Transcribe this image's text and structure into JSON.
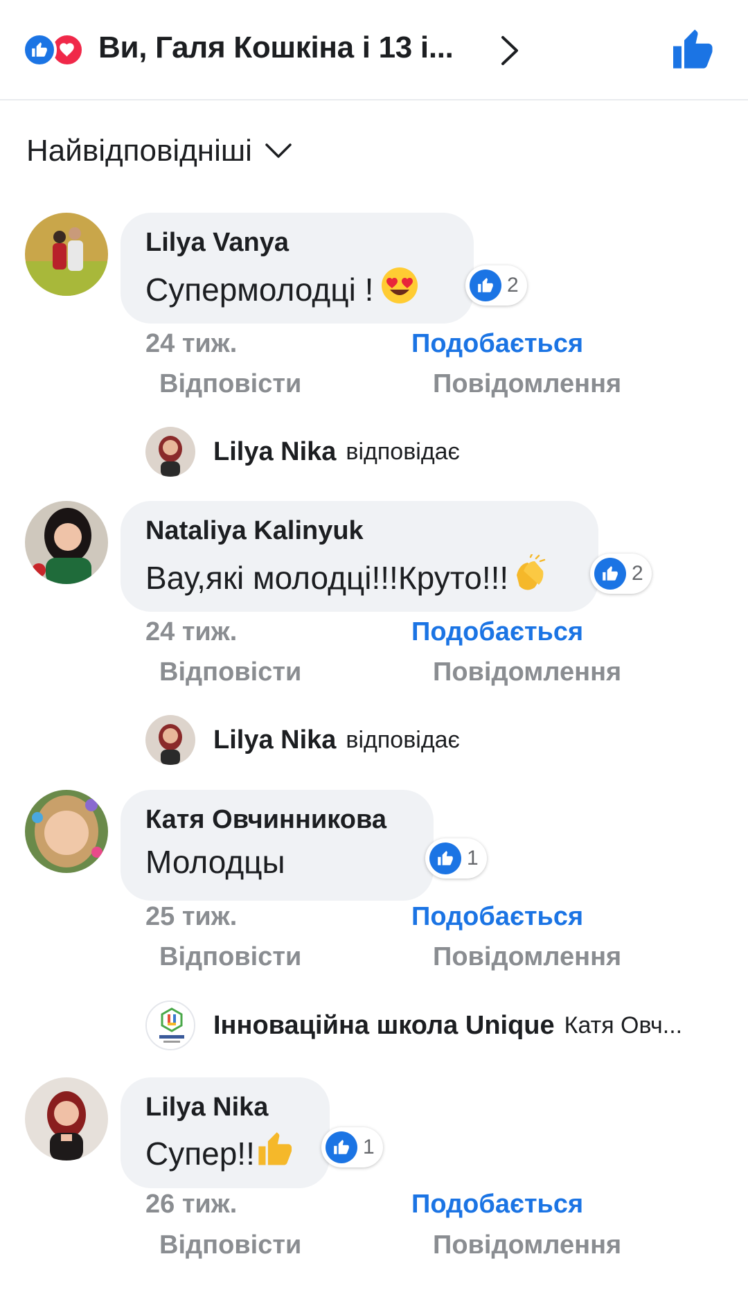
{
  "header": {
    "title": "Ви, Галя Кошкіна і 13 і...",
    "reaction_icons": [
      "like-icon",
      "love-icon"
    ],
    "accent_color": "#1b74e4",
    "love_color": "#f02849"
  },
  "sort": {
    "label": "Найвідповідніші"
  },
  "comments": [
    {
      "author": "Lilya Vanya",
      "text": "Супермолодці  !",
      "emoji": "heart-eyes-emoji",
      "reaction_count": "2",
      "time": "24 тиж.",
      "like_label": "Подобається",
      "reply_label": "Відповісти",
      "report_label": "Повідомлення",
      "reply": {
        "author": "Lilya Nika",
        "action": "відповідає"
      }
    },
    {
      "author": "Nataliya Kalinyuk",
      "text": "Вау,які молодці!!!Круто!!!",
      "emoji": "clapping-hands-emoji",
      "reaction_count": "2",
      "time": "24 тиж.",
      "like_label": "Подобається",
      "reply_label": "Відповісти",
      "report_label": "Повідомлення",
      "reply": {
        "author": "Lilya Nika",
        "action": "відповідає"
      }
    },
    {
      "author": "Катя Овчинникова",
      "text": "Молодцы",
      "emoji": "",
      "reaction_count": "1",
      "time": "25 тиж.",
      "like_label": "Подобається",
      "reply_label": "Відповісти",
      "report_label": "Повідомлення",
      "reply": {
        "author": "Інноваційна школа Unique",
        "action": "Катя Овч..."
      }
    },
    {
      "author": "Lilya Nika",
      "text": "Супер!!",
      "emoji": "thumbs-up-emoji",
      "reaction_count": "1",
      "time": "26 тиж.",
      "like_label": "Подобається",
      "reply_label": "Відповісти",
      "report_label": "Повідомлення"
    }
  ]
}
